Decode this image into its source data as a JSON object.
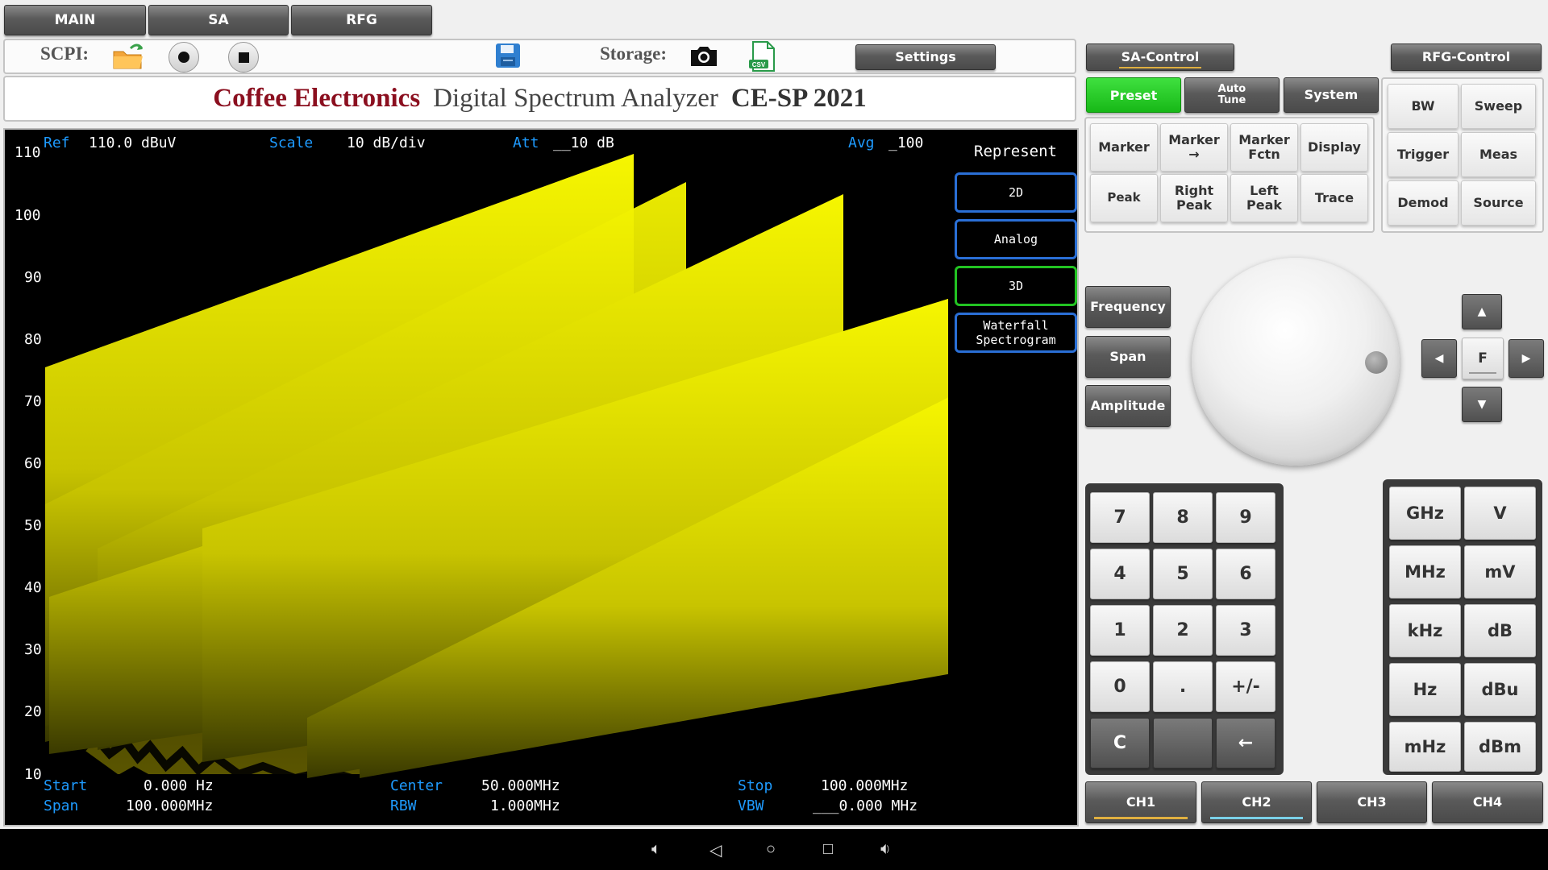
{
  "top_tabs": [
    "MAIN",
    "SA",
    "RFG"
  ],
  "toolbar": {
    "scpi_label": "SCPI:",
    "storage_label": "Storage:",
    "settings_label": "Settings",
    "sa_control_label": "SA-Control",
    "rfg_control_label": "RFG-Control"
  },
  "title": {
    "brand": "Coffee Electronics",
    "product": "Digital Spectrum Analyzer",
    "model": "CE-SP 2021"
  },
  "screen": {
    "ref_label": "Ref",
    "ref_value": "110.0 dBuV",
    "scale_label": "Scale",
    "scale_value": "10 dB/div",
    "att_label": "Att",
    "att_value": "__10 dB",
    "avg_label": "Avg",
    "avg_value": "_100",
    "y_ticks": [
      "110",
      "100",
      "90",
      "80",
      "70",
      "60",
      "50",
      "40",
      "30",
      "20",
      "10"
    ],
    "start_label": "Start",
    "start_value": "0.000 Hz",
    "span_label": "Span",
    "span_value": "100.000MHz",
    "center_label": "Center",
    "center_value": "50.000MHz",
    "rbw_label": "RBW",
    "rbw_value": "1.000MHz",
    "stop_label": "Stop",
    "stop_value": "100.000MHz",
    "vbw_label": "VBW",
    "vbw_value": "___0.000 MHz",
    "trace_color": "#f0f000"
  },
  "represent": {
    "title": "Represent",
    "options": [
      "2D",
      "Analog",
      "3D",
      "Waterfall\nSpectrogram"
    ],
    "selected": "3D"
  },
  "sa_menu": {
    "preset": "Preset",
    "auto_tune": "Auto\nTune",
    "system": "System",
    "grid": [
      "Marker",
      "Marker\n→",
      "Marker\nFctn",
      "Display",
      "Peak",
      "Right\nPeak",
      "Left\nPeak",
      "Trace"
    ]
  },
  "rfg_menu": [
    "BW",
    "Sweep",
    "Trigger",
    "Meas",
    "Demod",
    "Source"
  ],
  "params": [
    "Frequency",
    "Span",
    "Amplitude"
  ],
  "dpad": {
    "center": "F"
  },
  "keypad": [
    "7",
    "8",
    "9",
    "4",
    "5",
    "6",
    "1",
    "2",
    "3",
    "0",
    ".",
    "+/-",
    "C",
    "",
    "←"
  ],
  "units": [
    "GHz",
    "V",
    "MHz",
    "mV",
    "kHz",
    "dB",
    "Hz",
    "dBu",
    "mHz",
    "dBm"
  ],
  "channels": [
    "CH1",
    "CH2",
    "CH3",
    "CH4"
  ],
  "colors": {
    "accent_green": "#22c322",
    "ch1_underline": "#e0b040",
    "ch2_underline": "#7ad0e8"
  }
}
